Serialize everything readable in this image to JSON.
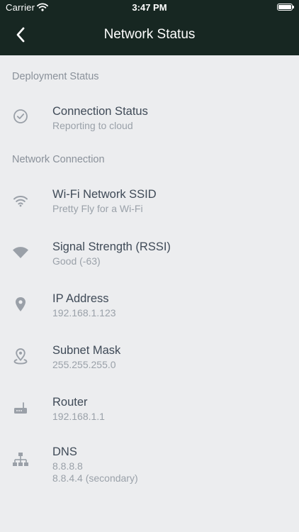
{
  "status_bar": {
    "carrier": "Carrier",
    "time": "3:47 PM"
  },
  "nav": {
    "title": "Network Status",
    "back_icon": "chevron-left-icon"
  },
  "colors": {
    "header_bg": "#172722",
    "page_bg": "#ecedef",
    "title_text": "#3f4a57",
    "subtitle_text": "#9aa1a9",
    "section_text": "#8a919a",
    "icon": "#9aa0a8"
  },
  "sections": [
    {
      "header": "Deployment Status",
      "items": [
        {
          "icon": "check-circle-icon",
          "title": "Connection Status",
          "subtitle": "Reporting to cloud"
        }
      ]
    },
    {
      "header": "Network Connection",
      "items": [
        {
          "icon": "wifi-icon",
          "title": "Wi-Fi Network SSID",
          "subtitle": "Pretty Fly for a Wi-Fi"
        },
        {
          "icon": "signal-strength-icon",
          "title": "Signal Strength (RSSI)",
          "subtitle": "Good (-63)"
        },
        {
          "icon": "location-pin-icon",
          "title": "IP Address",
          "subtitle": "192.168.1.123"
        },
        {
          "icon": "location-pin-outline-icon",
          "title": "Subnet Mask",
          "subtitle": "255.255.255.0"
        },
        {
          "icon": "router-icon",
          "title": "Router",
          "subtitle": "192.168.1.1"
        },
        {
          "icon": "network-tree-icon",
          "title": "DNS",
          "subtitle": "8.8.8.8",
          "subtitle2": "8.8.4.4 (secondary)"
        }
      ]
    }
  ]
}
